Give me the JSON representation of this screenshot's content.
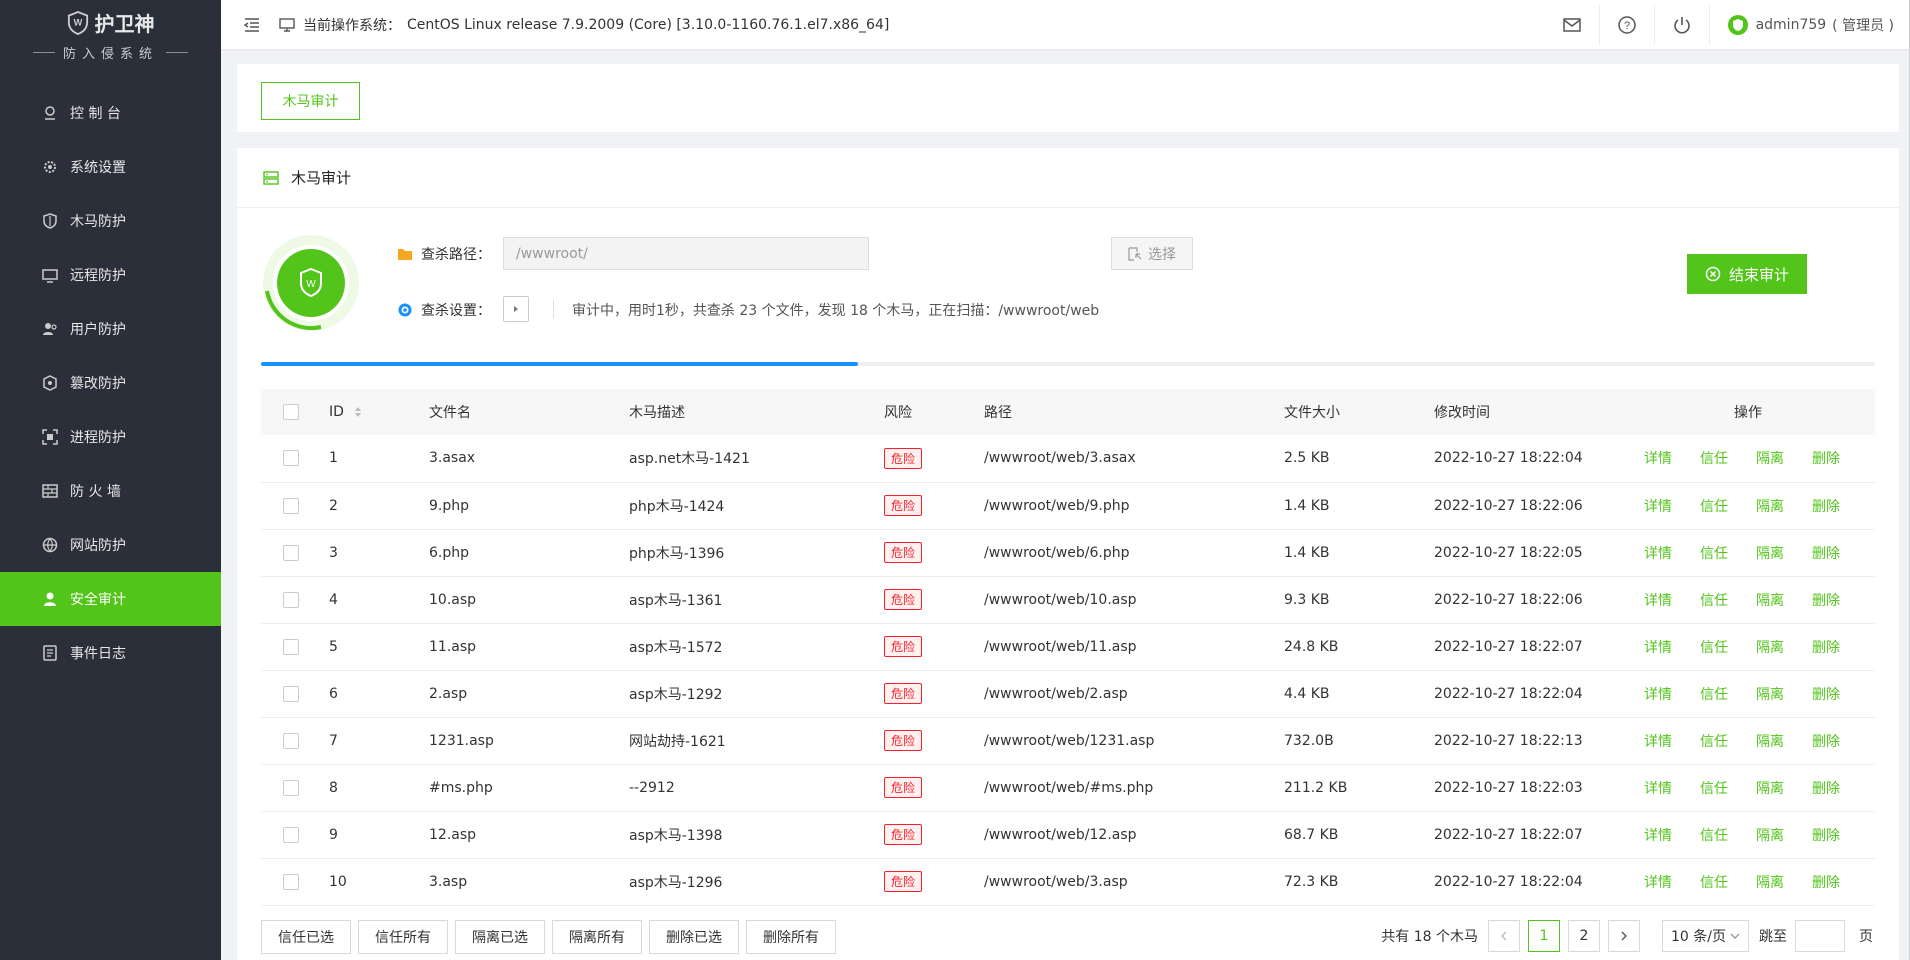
{
  "brand": {
    "name": "护卫神",
    "subtitle": "防入侵系统"
  },
  "sidebar": {
    "items": [
      {
        "label": "控 制 台",
        "icon": "dashboard-icon",
        "active": false
      },
      {
        "label": "系统设置",
        "icon": "settings-icon",
        "active": false
      },
      {
        "label": "木马防护",
        "icon": "shield-icon",
        "active": false
      },
      {
        "label": "远程防护",
        "icon": "remote-icon",
        "active": false
      },
      {
        "label": "用户防护",
        "icon": "users-icon",
        "active": false
      },
      {
        "label": "篡改防护",
        "icon": "tamper-icon",
        "active": false
      },
      {
        "label": "进程防护",
        "icon": "process-icon",
        "active": false
      },
      {
        "label": "防 火 墙",
        "icon": "firewall-icon",
        "active": false
      },
      {
        "label": "网站防护",
        "icon": "globe-icon",
        "active": false
      },
      {
        "label": "安全审计",
        "icon": "audit-icon",
        "active": true
      },
      {
        "label": "事件日志",
        "icon": "log-icon",
        "active": false
      }
    ]
  },
  "topbar": {
    "sys_prefix": "当前操作系统：",
    "sys_value": "CentOS Linux release 7.9.2009 (Core) [3.10.0-1160.76.1.el7.x86_64]",
    "user": "admin759",
    "role": "( 管理员 )"
  },
  "tabs": {
    "active_label": "木马审计"
  },
  "panel": {
    "title": "木马审计",
    "path_label": "查杀路径：",
    "path_value": "/wwwroot/",
    "choose_label": "选择",
    "settings_label": "查杀设置：",
    "status": "审计中，用时1秒，共查杀 23 个文件，发现 18 个木马，正在扫描：/wwwroot/web",
    "end_button": "结束审计",
    "progress": 0.37
  },
  "table": {
    "headers": [
      "ID",
      "文件名",
      "木马描述",
      "风险",
      "路径",
      "文件大小",
      "修改时间",
      "操作"
    ],
    "actions": [
      "详情",
      "信任",
      "隔离",
      "删除"
    ],
    "rows": [
      {
        "id": "1",
        "file": "3.asax",
        "desc": "asp.net木马-1421",
        "risk": "危险",
        "path": "/wwwroot/web/3.asax",
        "size": "2.5 KB",
        "time": "2022-10-27 18:22:04"
      },
      {
        "id": "2",
        "file": "9.php",
        "desc": "php木马-1424",
        "risk": "危险",
        "path": "/wwwroot/web/9.php",
        "size": "1.4 KB",
        "time": "2022-10-27 18:22:06"
      },
      {
        "id": "3",
        "file": "6.php",
        "desc": "php木马-1396",
        "risk": "危险",
        "path": "/wwwroot/web/6.php",
        "size": "1.4 KB",
        "time": "2022-10-27 18:22:05"
      },
      {
        "id": "4",
        "file": "10.asp",
        "desc": "asp木马-1361",
        "risk": "危险",
        "path": "/wwwroot/web/10.asp",
        "size": "9.3 KB",
        "time": "2022-10-27 18:22:06"
      },
      {
        "id": "5",
        "file": "11.asp",
        "desc": "asp木马-1572",
        "risk": "危险",
        "path": "/wwwroot/web/11.asp",
        "size": "24.8 KB",
        "time": "2022-10-27 18:22:07"
      },
      {
        "id": "6",
        "file": "2.asp",
        "desc": "asp木马-1292",
        "risk": "危险",
        "path": "/wwwroot/web/2.asp",
        "size": "4.4 KB",
        "time": "2022-10-27 18:22:04"
      },
      {
        "id": "7",
        "file": "1231.asp",
        "desc": "网站劫持-1621",
        "risk": "危险",
        "path": "/wwwroot/web/1231.asp",
        "size": "732.0B",
        "time": "2022-10-27 18:22:13"
      },
      {
        "id": "8",
        "file": "#ms.php",
        "desc": "--2912",
        "risk": "危险",
        "path": "/wwwroot/web/#ms.php",
        "size": "211.2 KB",
        "time": "2022-10-27 18:22:03"
      },
      {
        "id": "9",
        "file": "12.asp",
        "desc": "asp木马-1398",
        "risk": "危险",
        "path": "/wwwroot/web/12.asp",
        "size": "68.7 KB",
        "time": "2022-10-27 18:22:07"
      },
      {
        "id": "10",
        "file": "3.asp",
        "desc": "asp木马-1296",
        "risk": "危险",
        "path": "/wwwroot/web/3.asp",
        "size": "72.3 KB",
        "time": "2022-10-27 18:22:04"
      }
    ]
  },
  "bulk": [
    "信任已选",
    "信任所有",
    "隔离已选",
    "隔离所有",
    "删除已选",
    "删除所有"
  ],
  "pager": {
    "total": "共有 18 个木马",
    "pages": [
      "1",
      "2"
    ],
    "current": "1",
    "page_size": "10 条/页",
    "jump_label": "跳至",
    "page_suffix": "页"
  },
  "colors": {
    "accent": "#52c41a",
    "danger": "#f5222d",
    "sidebar": "#2b2f3a",
    "progress": "#1890ff"
  }
}
